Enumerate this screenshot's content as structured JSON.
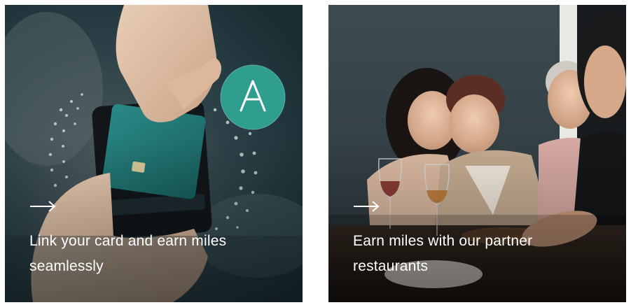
{
  "cards": [
    {
      "title": "Link your card and earn miles seamlessly",
      "arrow_icon": "arrow-right-icon",
      "logo_icon": "brand-a-logo-icon"
    },
    {
      "title": "Earn miles with our partner restaurants",
      "arrow_icon": "arrow-right-icon"
    }
  ],
  "colors": {
    "text": "#ffffff",
    "logo_badge": "#2f9e8f",
    "card_teal": "#1e6f6b"
  }
}
